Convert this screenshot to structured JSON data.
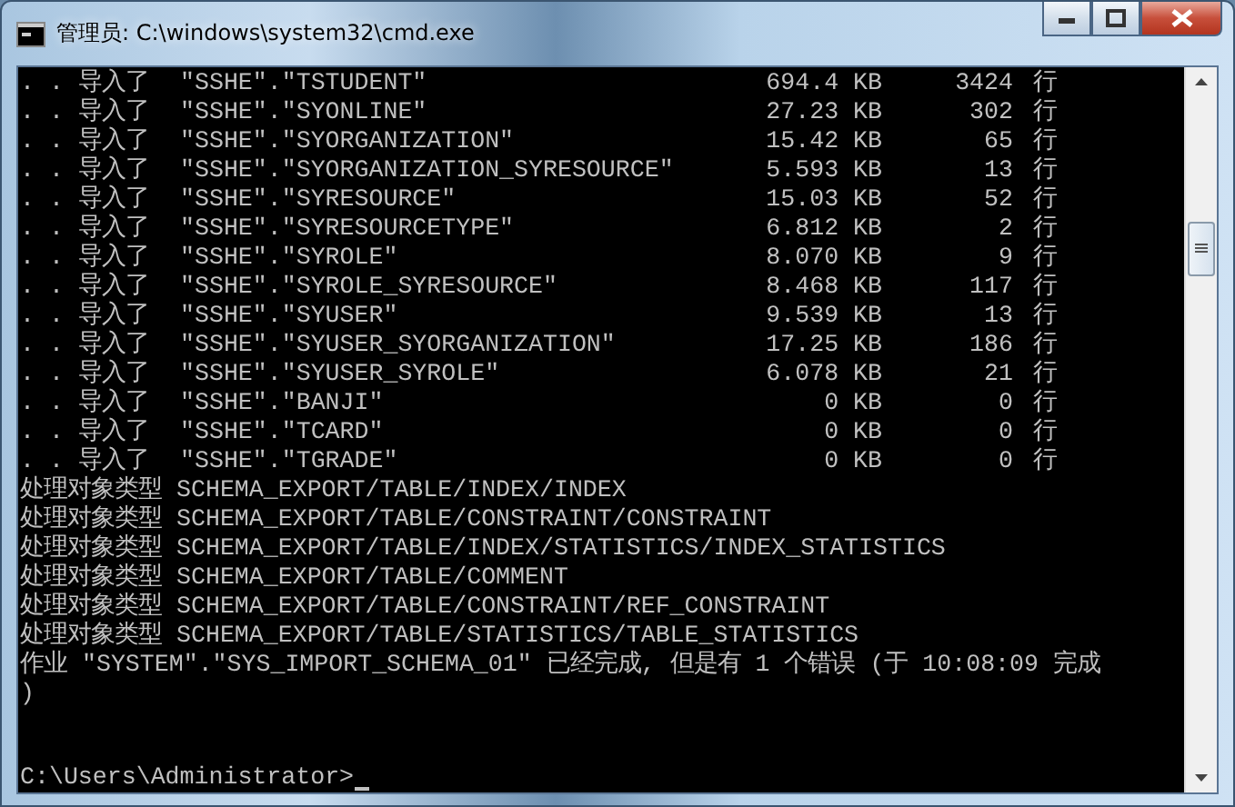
{
  "window": {
    "title": "管理员: C:\\windows\\system32\\cmd.exe"
  },
  "import_rows": [
    {
      "prefix": ". . 导入了",
      "name": "\"SSHE\".\"TSTUDENT\"",
      "size": "694.4 KB",
      "count": "3424",
      "unit": "行"
    },
    {
      "prefix": ". . 导入了",
      "name": "\"SSHE\".\"SYONLINE\"",
      "size": "27.23 KB",
      "count": "302",
      "unit": "行"
    },
    {
      "prefix": ". . 导入了",
      "name": "\"SSHE\".\"SYORGANIZATION\"",
      "size": "15.42 KB",
      "count": "65",
      "unit": "行"
    },
    {
      "prefix": ". . 导入了",
      "name": "\"SSHE\".\"SYORGANIZATION_SYRESOURCE\"",
      "size": "5.593 KB",
      "count": "13",
      "unit": "行"
    },
    {
      "prefix": ". . 导入了",
      "name": "\"SSHE\".\"SYRESOURCE\"",
      "size": "15.03 KB",
      "count": "52",
      "unit": "行"
    },
    {
      "prefix": ". . 导入了",
      "name": "\"SSHE\".\"SYRESOURCETYPE\"",
      "size": "6.812 KB",
      "count": "2",
      "unit": "行"
    },
    {
      "prefix": ". . 导入了",
      "name": "\"SSHE\".\"SYROLE\"",
      "size": "8.070 KB",
      "count": "9",
      "unit": "行"
    },
    {
      "prefix": ". . 导入了",
      "name": "\"SSHE\".\"SYROLE_SYRESOURCE\"",
      "size": "8.468 KB",
      "count": "117",
      "unit": "行"
    },
    {
      "prefix": ". . 导入了",
      "name": "\"SSHE\".\"SYUSER\"",
      "size": "9.539 KB",
      "count": "13",
      "unit": "行"
    },
    {
      "prefix": ". . 导入了",
      "name": "\"SSHE\".\"SYUSER_SYORGANIZATION\"",
      "size": "17.25 KB",
      "count": "186",
      "unit": "行"
    },
    {
      "prefix": ". . 导入了",
      "name": "\"SSHE\".\"SYUSER_SYROLE\"",
      "size": "6.078 KB",
      "count": "21",
      "unit": "行"
    },
    {
      "prefix": ". . 导入了",
      "name": "\"SSHE\".\"BANJI\"",
      "size": "0 KB",
      "count": "0",
      "unit": "行"
    },
    {
      "prefix": ". . 导入了",
      "name": "\"SSHE\".\"TCARD\"",
      "size": "0 KB",
      "count": "0",
      "unit": "行"
    },
    {
      "prefix": ". . 导入了",
      "name": "\"SSHE\".\"TGRADE\"",
      "size": "0 KB",
      "count": "0",
      "unit": "行"
    }
  ],
  "process_rows": [
    {
      "label": "处理对象类型",
      "path": "SCHEMA_EXPORT/TABLE/INDEX/INDEX"
    },
    {
      "label": "处理对象类型",
      "path": "SCHEMA_EXPORT/TABLE/CONSTRAINT/CONSTRAINT"
    },
    {
      "label": "处理对象类型",
      "path": "SCHEMA_EXPORT/TABLE/INDEX/STATISTICS/INDEX_STATISTICS"
    },
    {
      "label": "处理对象类型",
      "path": "SCHEMA_EXPORT/TABLE/COMMENT"
    },
    {
      "label": "处理对象类型",
      "path": "SCHEMA_EXPORT/TABLE/CONSTRAINT/REF_CONSTRAINT"
    },
    {
      "label": "处理对象类型",
      "path": "SCHEMA_EXPORT/TABLE/STATISTICS/TABLE_STATISTICS"
    }
  ],
  "job_line": "作业 \"SYSTEM\".\"SYS_IMPORT_SCHEMA_01\" 已经完成, 但是有 1 个错误 (于 10:08:09 完成",
  "job_line_end": ")",
  "prompt": "C:\\Users\\Administrator>"
}
